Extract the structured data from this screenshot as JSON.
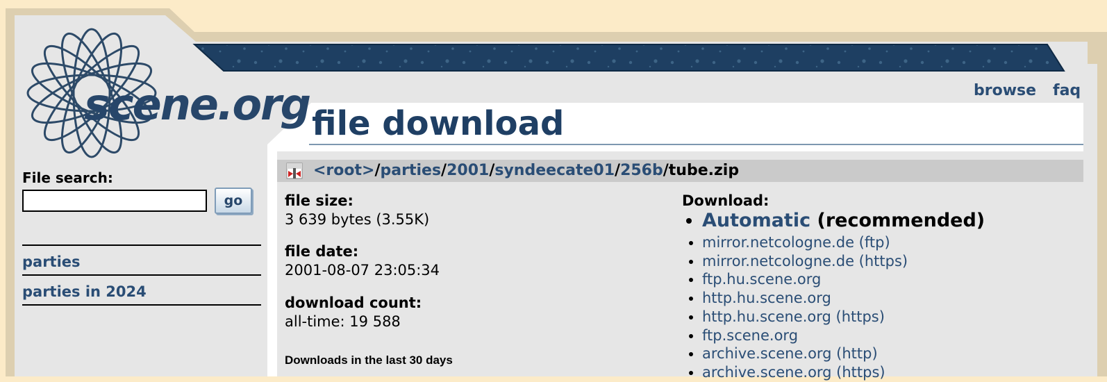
{
  "logo": {
    "text": "scene.org"
  },
  "sidebar": {
    "search_label": "File search:",
    "search_value": "",
    "go_label": "go",
    "links": [
      "parties",
      "parties in 2024"
    ]
  },
  "nav": {
    "browse": "browse",
    "faq": "faq"
  },
  "page_title": "file download",
  "path": {
    "root": "<root>",
    "parties": "parties",
    "year": "2001",
    "party": "syndeecate01",
    "category": "256b",
    "separator": "/",
    "file": "tube.zip"
  },
  "file_info": {
    "size_label": "file size:",
    "size_value": "3 639 bytes (3.55K)",
    "date_label": "file date:",
    "date_value": "2001-08-07 23:05:34",
    "count_label": "download count:",
    "count_value": "all-time: 19 588",
    "last30_label": "Downloads in the last 30 days"
  },
  "download": {
    "label": "Download:",
    "automatic": "Automatic",
    "recommended": " (recommended)",
    "mirrors": [
      "mirror.netcologne.de (ftp)",
      "mirror.netcologne.de (https)",
      "ftp.hu.scene.org",
      "http.hu.scene.org",
      "http.hu.scene.org (https)",
      "ftp.scene.org",
      "archive.scene.org (http)",
      "archive.scene.org (https)"
    ]
  },
  "colors": {
    "page_background": "#fcebc8",
    "panel_background": "#e6e6e6",
    "banner": "#1e3f62",
    "link": "#2a4d75",
    "path_bar": "#cacaca"
  }
}
